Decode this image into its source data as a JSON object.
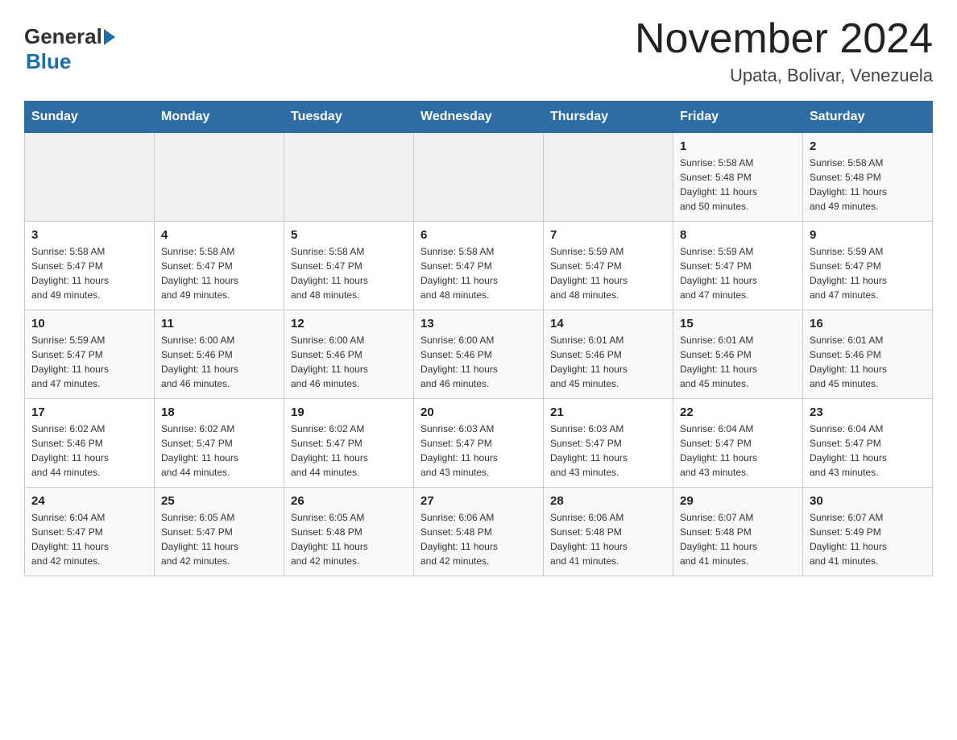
{
  "header": {
    "logo_general": "General",
    "logo_blue": "Blue",
    "month_year": "November 2024",
    "location": "Upata, Bolivar, Venezuela"
  },
  "days_of_week": [
    "Sunday",
    "Monday",
    "Tuesday",
    "Wednesday",
    "Thursday",
    "Friday",
    "Saturday"
  ],
  "weeks": [
    [
      {
        "day": "",
        "info": ""
      },
      {
        "day": "",
        "info": ""
      },
      {
        "day": "",
        "info": ""
      },
      {
        "day": "",
        "info": ""
      },
      {
        "day": "",
        "info": ""
      },
      {
        "day": "1",
        "info": "Sunrise: 5:58 AM\nSunset: 5:48 PM\nDaylight: 11 hours\nand 50 minutes."
      },
      {
        "day": "2",
        "info": "Sunrise: 5:58 AM\nSunset: 5:48 PM\nDaylight: 11 hours\nand 49 minutes."
      }
    ],
    [
      {
        "day": "3",
        "info": "Sunrise: 5:58 AM\nSunset: 5:47 PM\nDaylight: 11 hours\nand 49 minutes."
      },
      {
        "day": "4",
        "info": "Sunrise: 5:58 AM\nSunset: 5:47 PM\nDaylight: 11 hours\nand 49 minutes."
      },
      {
        "day": "5",
        "info": "Sunrise: 5:58 AM\nSunset: 5:47 PM\nDaylight: 11 hours\nand 48 minutes."
      },
      {
        "day": "6",
        "info": "Sunrise: 5:58 AM\nSunset: 5:47 PM\nDaylight: 11 hours\nand 48 minutes."
      },
      {
        "day": "7",
        "info": "Sunrise: 5:59 AM\nSunset: 5:47 PM\nDaylight: 11 hours\nand 48 minutes."
      },
      {
        "day": "8",
        "info": "Sunrise: 5:59 AM\nSunset: 5:47 PM\nDaylight: 11 hours\nand 47 minutes."
      },
      {
        "day": "9",
        "info": "Sunrise: 5:59 AM\nSunset: 5:47 PM\nDaylight: 11 hours\nand 47 minutes."
      }
    ],
    [
      {
        "day": "10",
        "info": "Sunrise: 5:59 AM\nSunset: 5:47 PM\nDaylight: 11 hours\nand 47 minutes."
      },
      {
        "day": "11",
        "info": "Sunrise: 6:00 AM\nSunset: 5:46 PM\nDaylight: 11 hours\nand 46 minutes."
      },
      {
        "day": "12",
        "info": "Sunrise: 6:00 AM\nSunset: 5:46 PM\nDaylight: 11 hours\nand 46 minutes."
      },
      {
        "day": "13",
        "info": "Sunrise: 6:00 AM\nSunset: 5:46 PM\nDaylight: 11 hours\nand 46 minutes."
      },
      {
        "day": "14",
        "info": "Sunrise: 6:01 AM\nSunset: 5:46 PM\nDaylight: 11 hours\nand 45 minutes."
      },
      {
        "day": "15",
        "info": "Sunrise: 6:01 AM\nSunset: 5:46 PM\nDaylight: 11 hours\nand 45 minutes."
      },
      {
        "day": "16",
        "info": "Sunrise: 6:01 AM\nSunset: 5:46 PM\nDaylight: 11 hours\nand 45 minutes."
      }
    ],
    [
      {
        "day": "17",
        "info": "Sunrise: 6:02 AM\nSunset: 5:46 PM\nDaylight: 11 hours\nand 44 minutes."
      },
      {
        "day": "18",
        "info": "Sunrise: 6:02 AM\nSunset: 5:47 PM\nDaylight: 11 hours\nand 44 minutes."
      },
      {
        "day": "19",
        "info": "Sunrise: 6:02 AM\nSunset: 5:47 PM\nDaylight: 11 hours\nand 44 minutes."
      },
      {
        "day": "20",
        "info": "Sunrise: 6:03 AM\nSunset: 5:47 PM\nDaylight: 11 hours\nand 43 minutes."
      },
      {
        "day": "21",
        "info": "Sunrise: 6:03 AM\nSunset: 5:47 PM\nDaylight: 11 hours\nand 43 minutes."
      },
      {
        "day": "22",
        "info": "Sunrise: 6:04 AM\nSunset: 5:47 PM\nDaylight: 11 hours\nand 43 minutes."
      },
      {
        "day": "23",
        "info": "Sunrise: 6:04 AM\nSunset: 5:47 PM\nDaylight: 11 hours\nand 43 minutes."
      }
    ],
    [
      {
        "day": "24",
        "info": "Sunrise: 6:04 AM\nSunset: 5:47 PM\nDaylight: 11 hours\nand 42 minutes."
      },
      {
        "day": "25",
        "info": "Sunrise: 6:05 AM\nSunset: 5:47 PM\nDaylight: 11 hours\nand 42 minutes."
      },
      {
        "day": "26",
        "info": "Sunrise: 6:05 AM\nSunset: 5:48 PM\nDaylight: 11 hours\nand 42 minutes."
      },
      {
        "day": "27",
        "info": "Sunrise: 6:06 AM\nSunset: 5:48 PM\nDaylight: 11 hours\nand 42 minutes."
      },
      {
        "day": "28",
        "info": "Sunrise: 6:06 AM\nSunset: 5:48 PM\nDaylight: 11 hours\nand 41 minutes."
      },
      {
        "day": "29",
        "info": "Sunrise: 6:07 AM\nSunset: 5:48 PM\nDaylight: 11 hours\nand 41 minutes."
      },
      {
        "day": "30",
        "info": "Sunrise: 6:07 AM\nSunset: 5:49 PM\nDaylight: 11 hours\nand 41 minutes."
      }
    ]
  ]
}
